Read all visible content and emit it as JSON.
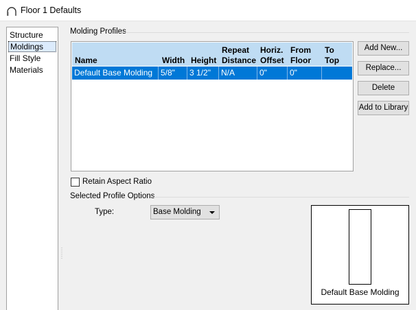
{
  "window": {
    "title": "Floor 1 Defaults",
    "icon": "arch-icon"
  },
  "sidebar": {
    "items": [
      {
        "label": "Structure",
        "selected": false
      },
      {
        "label": "Moldings",
        "selected": true
      },
      {
        "label": "Fill Style",
        "selected": false
      },
      {
        "label": "Materials",
        "selected": false
      }
    ]
  },
  "molding_profiles": {
    "group_label": "Molding Profiles",
    "columns": {
      "name": "Name",
      "width": "Width",
      "height": "Height",
      "repeat_distance": [
        "Repeat",
        "Distance"
      ],
      "horiz_offset": [
        "Horiz.",
        "Offset"
      ],
      "from_floor": [
        "From",
        "Floor"
      ],
      "to_top": [
        "To",
        "Top"
      ]
    },
    "rows": [
      {
        "name": "Default Base Molding",
        "width": "5/8\"",
        "height": "3 1/2\"",
        "repeat_distance": "N/A",
        "horiz_offset": "0\"",
        "from_floor": "0\"",
        "to_top": "",
        "selected": true
      }
    ],
    "buttons": {
      "add_new": "Add New...",
      "replace": "Replace...",
      "delete": "Delete",
      "add_to_library": "Add to Library"
    }
  },
  "retain_aspect_ratio": {
    "label": "Retain Aspect Ratio",
    "checked": false
  },
  "selected_profile_options": {
    "group_label": "Selected Profile Options",
    "type_label": "Type:",
    "type_value": "Base Molding",
    "preview_caption": "Default Base Molding"
  },
  "colors": {
    "selection": "#0078d7",
    "header": "#bfdcf3",
    "dialog_bg": "#f0f0f0"
  }
}
